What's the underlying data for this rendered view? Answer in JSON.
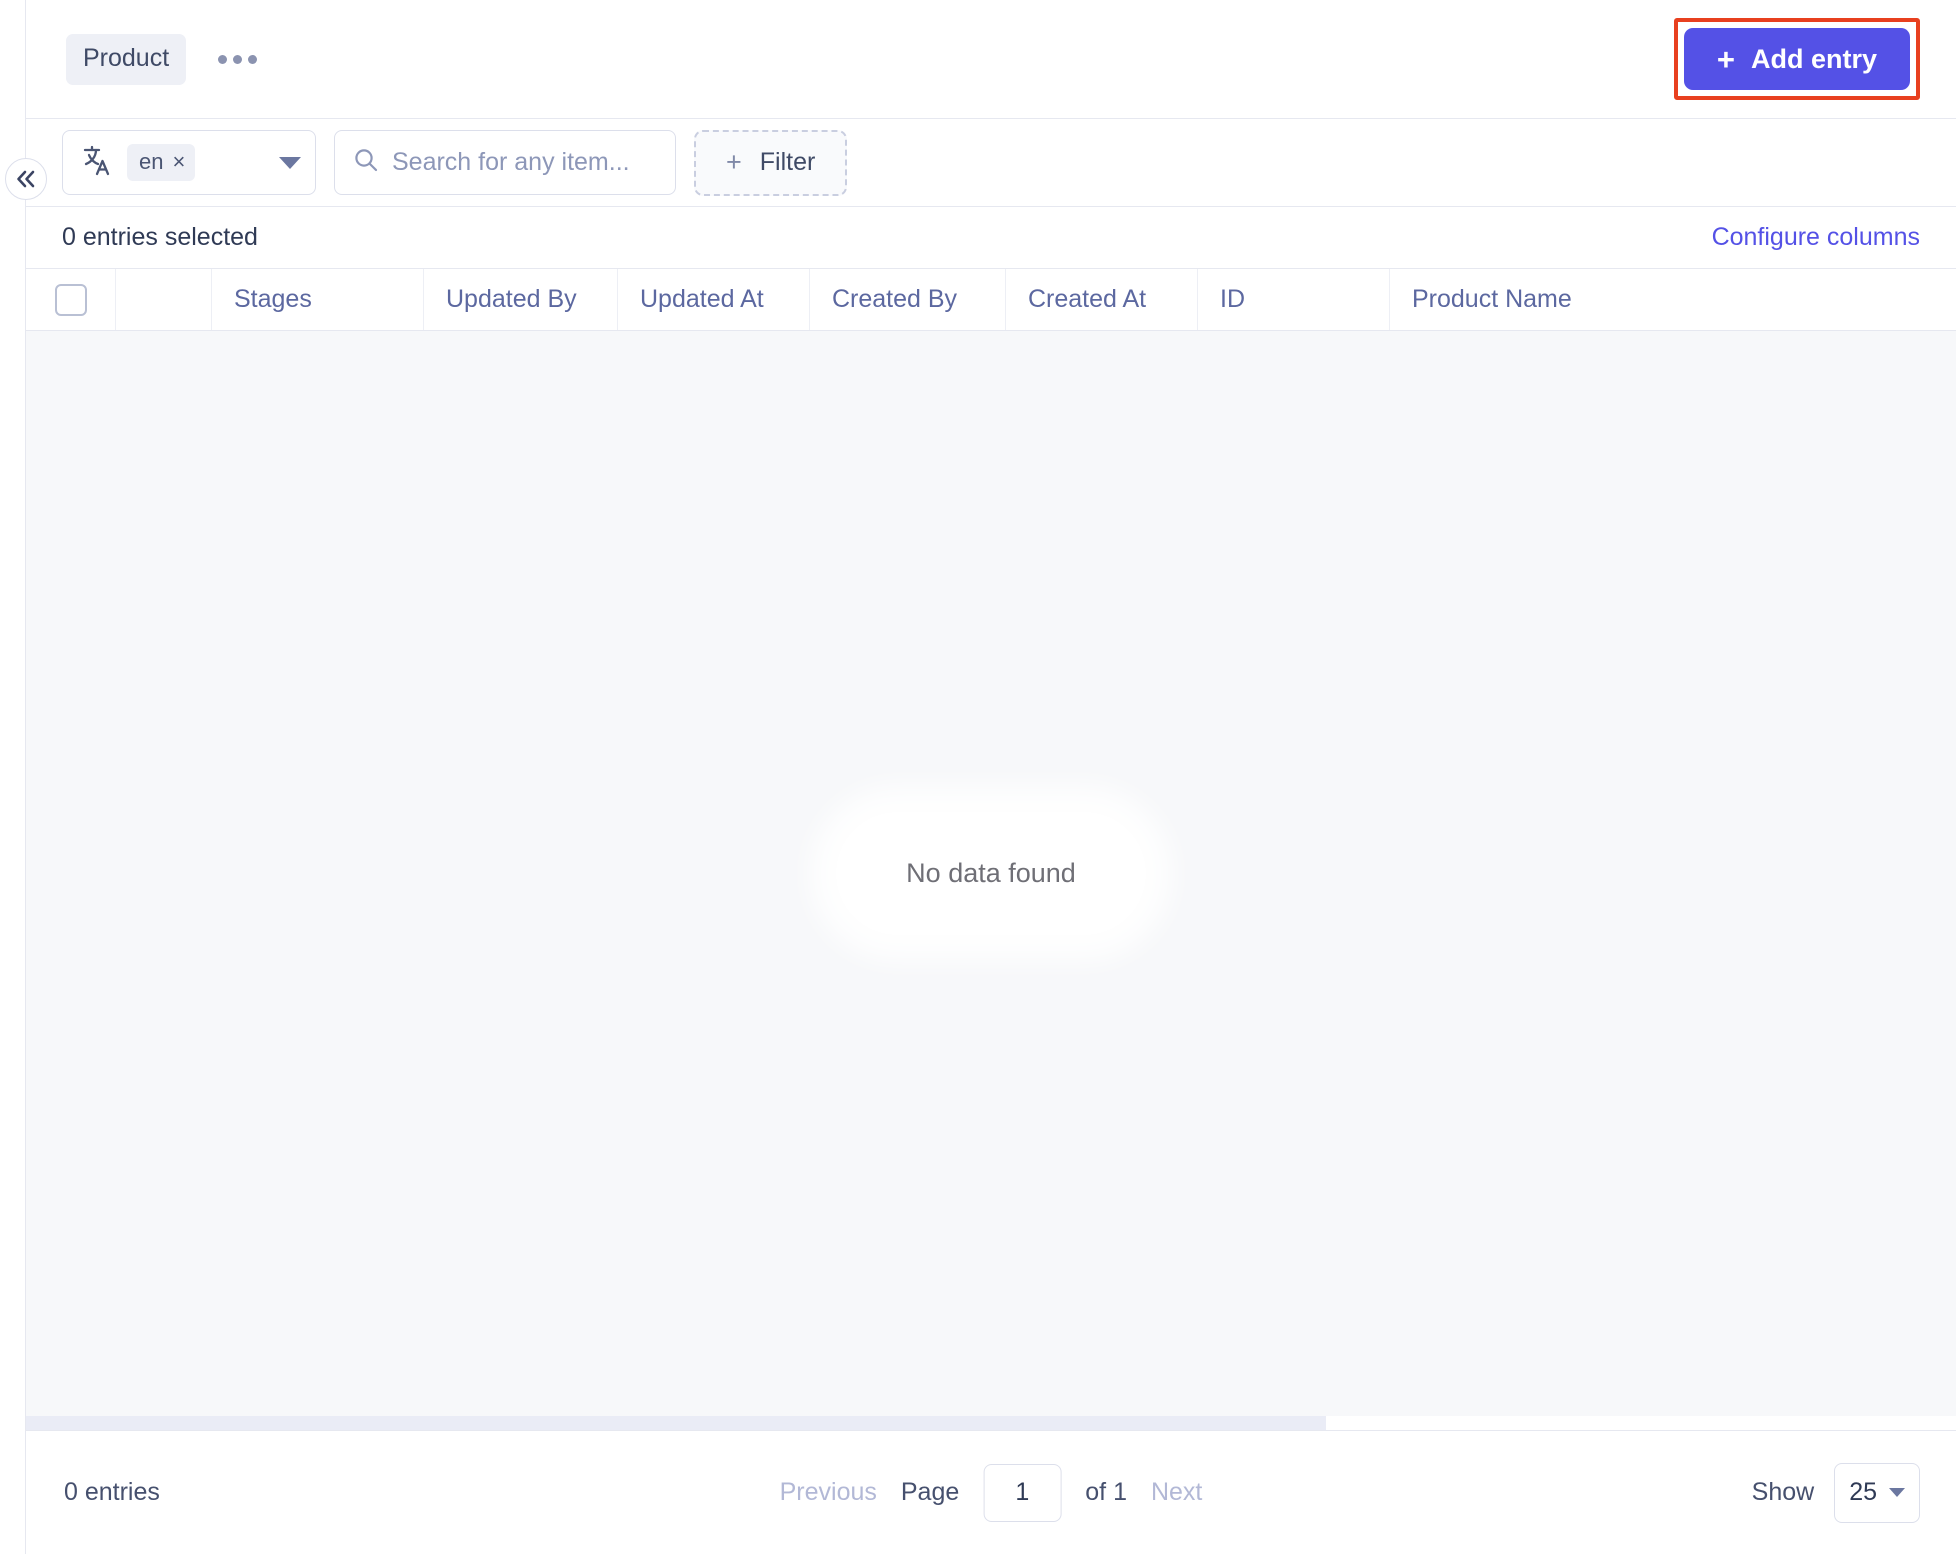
{
  "header": {
    "breadcrumb_label": "Product",
    "more_icon": "ellipsis-icon",
    "add_entry_label": "Add entry",
    "add_entry_plus": "+",
    "accent_color": "#5451e6",
    "annotation_color": "#e8401f"
  },
  "sidebar": {
    "collapse_icon": "chevron-double-left-icon"
  },
  "toolbar": {
    "locale_icon": "translate-icon",
    "locale_value": "en",
    "locale_remove": "×",
    "locale_caret": "chevron-down-icon",
    "search_icon": "search-icon",
    "search_value": "",
    "search_placeholder": "Search for any item...",
    "filter_label": "Filter",
    "filter_plus": "+"
  },
  "selection": {
    "count_label": "0 entries selected",
    "configure_columns_label": "Configure columns"
  },
  "table": {
    "columns": [
      {
        "key": "select",
        "label": ""
      },
      {
        "key": "spacer",
        "label": ""
      },
      {
        "key": "stages",
        "label": "Stages"
      },
      {
        "key": "updated_by",
        "label": "Updated By"
      },
      {
        "key": "updated_at",
        "label": "Updated At"
      },
      {
        "key": "created_by",
        "label": "Created By"
      },
      {
        "key": "created_at",
        "label": "Created At"
      },
      {
        "key": "id",
        "label": "ID"
      },
      {
        "key": "product_name",
        "label": "Product Name"
      }
    ],
    "rows": [],
    "empty_message": "No data found"
  },
  "footer": {
    "entries_total_label": "0 entries",
    "previous_label": "Previous",
    "page_label": "Page",
    "page_value": "1",
    "of_label": "of 1",
    "next_label": "Next",
    "show_label": "Show",
    "show_value": "25"
  }
}
